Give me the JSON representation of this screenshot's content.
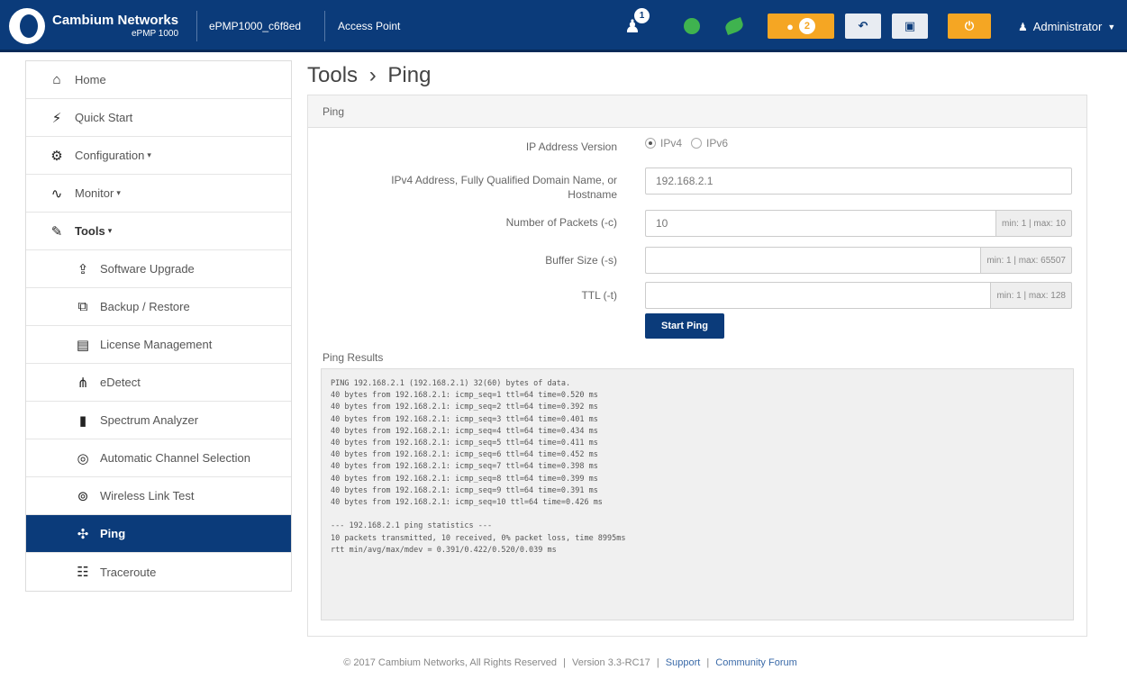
{
  "navbar": {
    "brand_name": "Cambium Networks",
    "brand_sub": "ePMP 1000",
    "device_name": "ePMP1000_c6f8ed",
    "device_mode": "Access Point",
    "notification_count": "1",
    "alert_count": "2",
    "user": "Administrator"
  },
  "sidebar": {
    "items": [
      {
        "label": "Home",
        "icon": "home-icon"
      },
      {
        "label": "Quick Start",
        "icon": "runner-icon"
      },
      {
        "label": "Configuration",
        "icon": "gear-icon"
      },
      {
        "label": "Monitor",
        "icon": "pulse-icon"
      },
      {
        "label": "Tools",
        "icon": "wrench-icon"
      },
      {
        "label": "Software Upgrade",
        "icon": "upgrade-icon"
      },
      {
        "label": "Backup / Restore",
        "icon": "backup-icon"
      },
      {
        "label": "License Management",
        "icon": "license-icon"
      },
      {
        "label": "eDetect",
        "icon": "edetect-icon"
      },
      {
        "label": "Spectrum Analyzer",
        "icon": "bar-chart-icon"
      },
      {
        "label": "Automatic Channel Selection",
        "icon": "channel-icon"
      },
      {
        "label": "Wireless Link Test",
        "icon": "link-test-icon"
      },
      {
        "label": "Ping",
        "icon": "ping-icon"
      },
      {
        "label": "Traceroute",
        "icon": "traceroute-icon"
      }
    ]
  },
  "page": {
    "title": "Tools",
    "title_sep": "›",
    "subtitle": "Ping"
  },
  "panel": {
    "heading": "Ping",
    "ip_version_label": "IP Address Version",
    "ipv4_label": "IPv4",
    "ipv6_label": "IPv6",
    "address_label": "IPv4 Address, Fully Qualified Domain Name, or Hostname",
    "address_value": "192.168.2.1",
    "packets_label": "Number of Packets (-c)",
    "packets_value": "10",
    "packets_hint": "min: 1 | max: 10",
    "buffer_label": "Buffer Size (-s)",
    "buffer_value": "",
    "buffer_hint": "min: 1 | max: 65507",
    "ttl_label": "TTL (-t)",
    "ttl_value": "",
    "ttl_hint": "min: 1 | max: 128",
    "start_button": "Start Ping",
    "results_label": "Ping Results",
    "results_text": "PING 192.168.2.1 (192.168.2.1) 32(60) bytes of data.\n40 bytes from 192.168.2.1: icmp_seq=1 ttl=64 time=0.520 ms\n40 bytes from 192.168.2.1: icmp_seq=2 ttl=64 time=0.392 ms\n40 bytes from 192.168.2.1: icmp_seq=3 ttl=64 time=0.401 ms\n40 bytes from 192.168.2.1: icmp_seq=4 ttl=64 time=0.434 ms\n40 bytes from 192.168.2.1: icmp_seq=5 ttl=64 time=0.411 ms\n40 bytes from 192.168.2.1: icmp_seq=6 ttl=64 time=0.452 ms\n40 bytes from 192.168.2.1: icmp_seq=7 ttl=64 time=0.398 ms\n40 bytes from 192.168.2.1: icmp_seq=8 ttl=64 time=0.399 ms\n40 bytes from 192.168.2.1: icmp_seq=9 ttl=64 time=0.391 ms\n40 bytes from 192.168.2.1: icmp_seq=10 ttl=64 time=0.426 ms\n\n--- 192.168.2.1 ping statistics ---\n10 packets transmitted, 10 received, 0% packet loss, time 8995ms\nrtt min/avg/max/mdev = 0.391/0.422/0.520/0.039 ms"
  },
  "footer": {
    "copyright": "© 2017 Cambium Networks, All Rights Reserved",
    "sep": "|",
    "version": "Version 3.3-RC17",
    "support": "Support",
    "forum": "Community Forum"
  },
  "colors": {
    "brand": "#0b3b7a",
    "accent_orange": "#f5a623",
    "status_green": "#3fb34f"
  }
}
